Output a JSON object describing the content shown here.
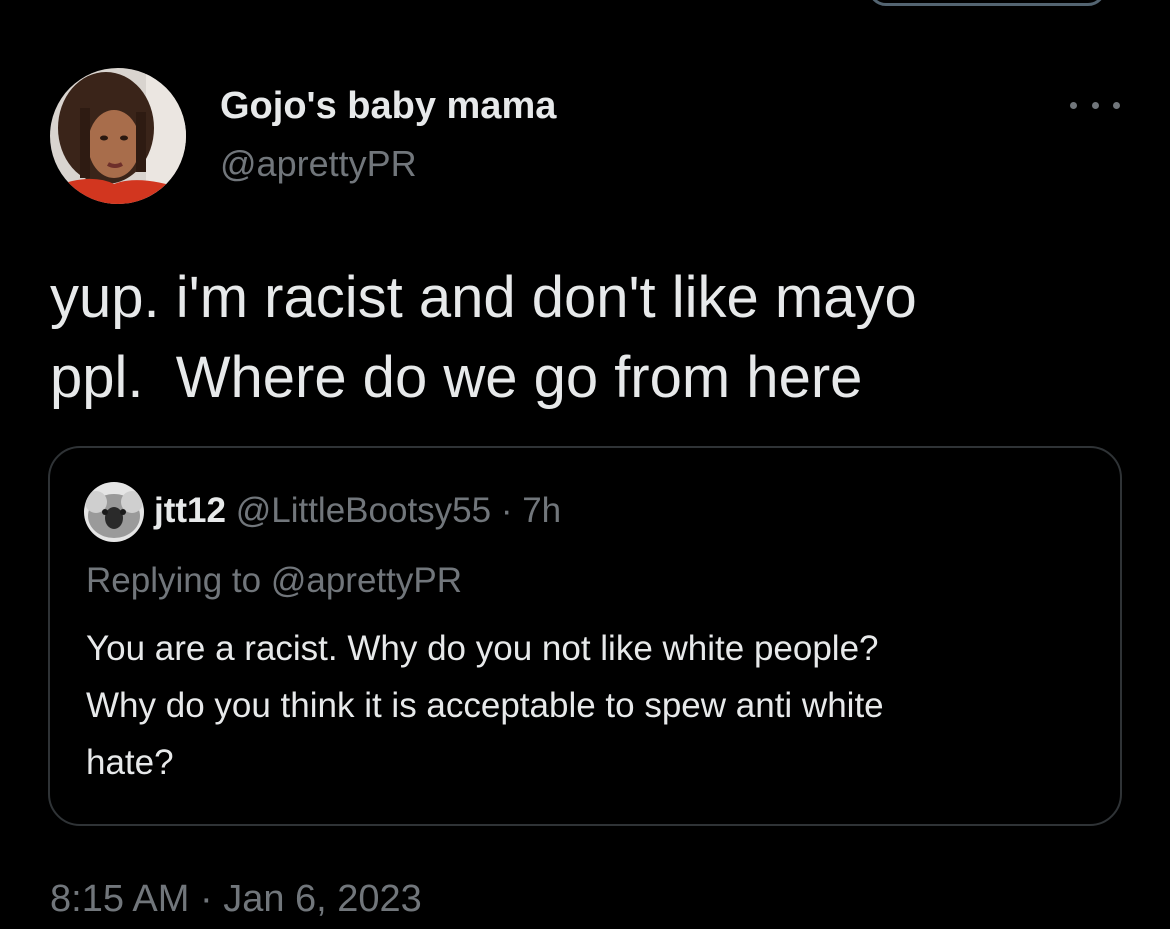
{
  "tweet": {
    "author": {
      "display_name": "Gojo's baby mama",
      "handle": "@aprettyPR"
    },
    "text_lines": [
      "yup. i'm racist and don't like mayo",
      "ppl.  Where do we go from here"
    ],
    "quoted_tweet": {
      "display_name": "jtt12",
      "handle": "@LittleBootsy55",
      "separator": "·",
      "age": "7h",
      "replying_to": "Replying to @aprettyPR",
      "text_lines": [
        "You are a racist. Why do you not like white people?",
        "Why do you think it is acceptable to spew anti white",
        "hate?"
      ]
    },
    "timestamp": "8:15 AM · Jan 6, 2023"
  },
  "icons": {
    "more": "more-dots-icon"
  },
  "colors": {
    "background": "#000000",
    "primary_text": "#e7e9ea",
    "secondary_text": "#71767b",
    "border": "#2f3336"
  }
}
